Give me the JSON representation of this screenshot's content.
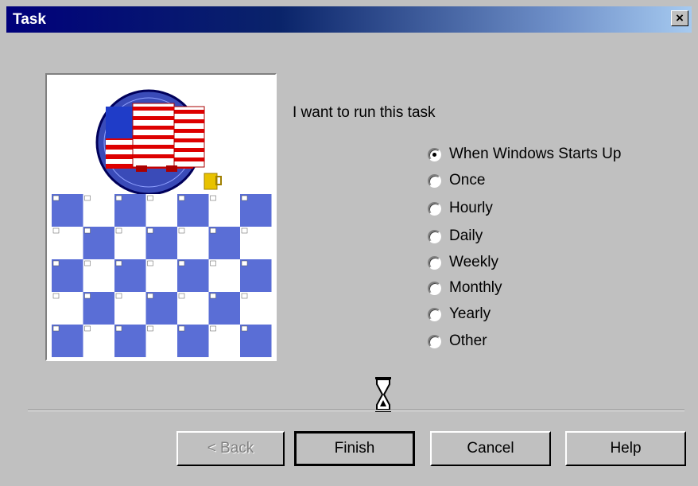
{
  "window": {
    "title": "Task",
    "close_label": "×"
  },
  "content": {
    "prompt": "I want to run this task",
    "selected_index": 0,
    "options": [
      "When Windows Starts Up",
      "Once",
      "Hourly",
      "Daily",
      "Weekly",
      "Monthly",
      "Yearly",
      "Other"
    ]
  },
  "buttons": {
    "back": "< Back",
    "finish": "Finish",
    "cancel": "Cancel",
    "help": "Help"
  },
  "icons": {
    "picture": "calendar-flag-illustration",
    "hourglass": "hourglass-icon",
    "close": "close-icon"
  },
  "colors": {
    "title_bar_start": "#00007b",
    "title_bar_end": "#a6caf0",
    "dialog_bg": "#c0c0c0",
    "calendar_blue": "#5a6ed6"
  }
}
